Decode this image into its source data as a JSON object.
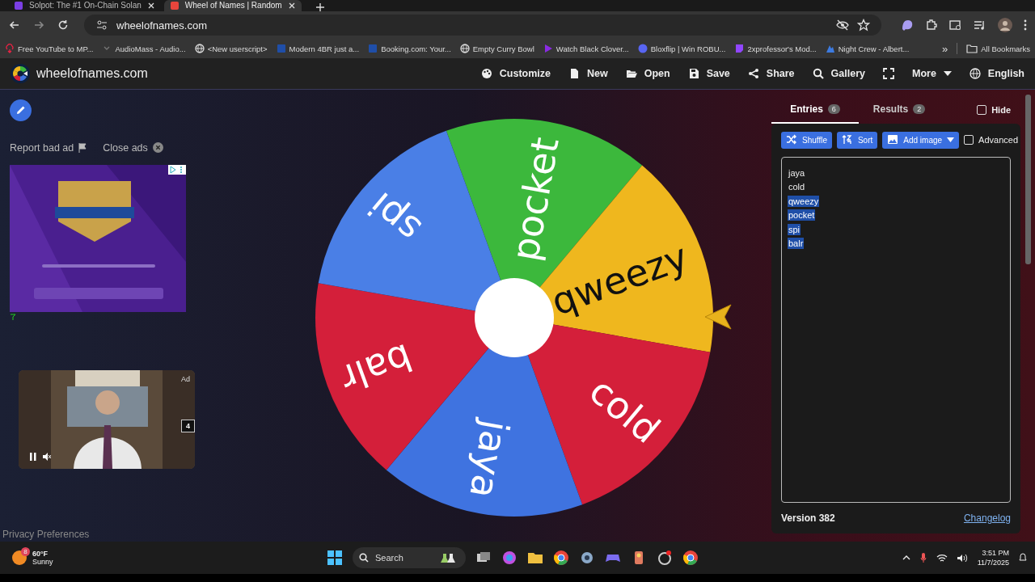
{
  "browser": {
    "tabs": [
      {
        "title": "Solpot: The #1 On-Chain Solan",
        "selected": false
      },
      {
        "title": "Wheel of Names | Random",
        "selected": true
      }
    ],
    "address": "wheelofnames.com",
    "bookmarks": [
      "Free YouTube to MP...",
      "AudioMass - Audio...",
      "<New userscript>",
      "Modern 4BR just a...",
      "Booking.com: Your...",
      "Empty Curry Bowl",
      "Watch Black Clover...",
      "Bloxflip | Win ROBU...",
      "2xprofessor's Mod...",
      "Night Crew - Albert..."
    ],
    "more_bookmarks": "»",
    "all_bookmarks": "All Bookmarks"
  },
  "site": {
    "name": "wheelofnames.com",
    "menu": [
      {
        "kind": "button",
        "label": "Customize"
      },
      {
        "kind": "button",
        "label": "New"
      },
      {
        "kind": "button",
        "label": "Open"
      },
      {
        "kind": "button",
        "label": "Save"
      },
      {
        "kind": "button",
        "label": "Share"
      },
      {
        "kind": "button",
        "label": "Gallery"
      },
      {
        "kind": "icon"
      },
      {
        "kind": "dropdown",
        "label": "More"
      },
      {
        "kind": "button",
        "label": "English"
      }
    ]
  },
  "ads": {
    "report": "Report bad ad",
    "close": "Close ads",
    "video_label": "Ad",
    "video_counter": "4"
  },
  "wheel": {
    "slices": [
      {
        "label": "pocket",
        "color": "#3cb83c"
      },
      {
        "label": "qweezy",
        "color": "#efb71e"
      },
      {
        "label": "cold",
        "color": "#d41f3a"
      },
      {
        "label": "jaya",
        "color": "#3f73e0"
      },
      {
        "label": "balr",
        "color": "#d41f3a"
      },
      {
        "label": "spi",
        "color": "#4a7fe6"
      }
    ]
  },
  "entries": {
    "tabs": [
      {
        "label": "Entries",
        "count": "6",
        "selected": true
      },
      {
        "label": "Results",
        "count": "2",
        "selected": false
      }
    ],
    "hide": {
      "label": "Hide",
      "checked": false
    },
    "tools": [
      {
        "kind": "button",
        "label": "Shuffle"
      },
      {
        "kind": "button",
        "label": "Sort"
      },
      {
        "kind": "dropdown",
        "label": "Add image"
      }
    ],
    "advanced": {
      "label": "Advanced",
      "checked": false
    },
    "list": [
      {
        "text": "jaya",
        "selected": false
      },
      {
        "text": "cold",
        "selected": false
      },
      {
        "text": "qweezy",
        "selected": true
      },
      {
        "text": "pocket",
        "selected": true
      },
      {
        "text": "spi",
        "selected": true
      },
      {
        "text": "balr",
        "selected": true
      }
    ],
    "version": "Version 382",
    "changelog": "Changelog"
  },
  "privacy": "Privacy Preferences",
  "taskbar": {
    "badge": "8",
    "temperature": "60°F",
    "condition": "Sunny",
    "search": "Search",
    "time": "3:51 PM",
    "date": "11/7/2025"
  }
}
